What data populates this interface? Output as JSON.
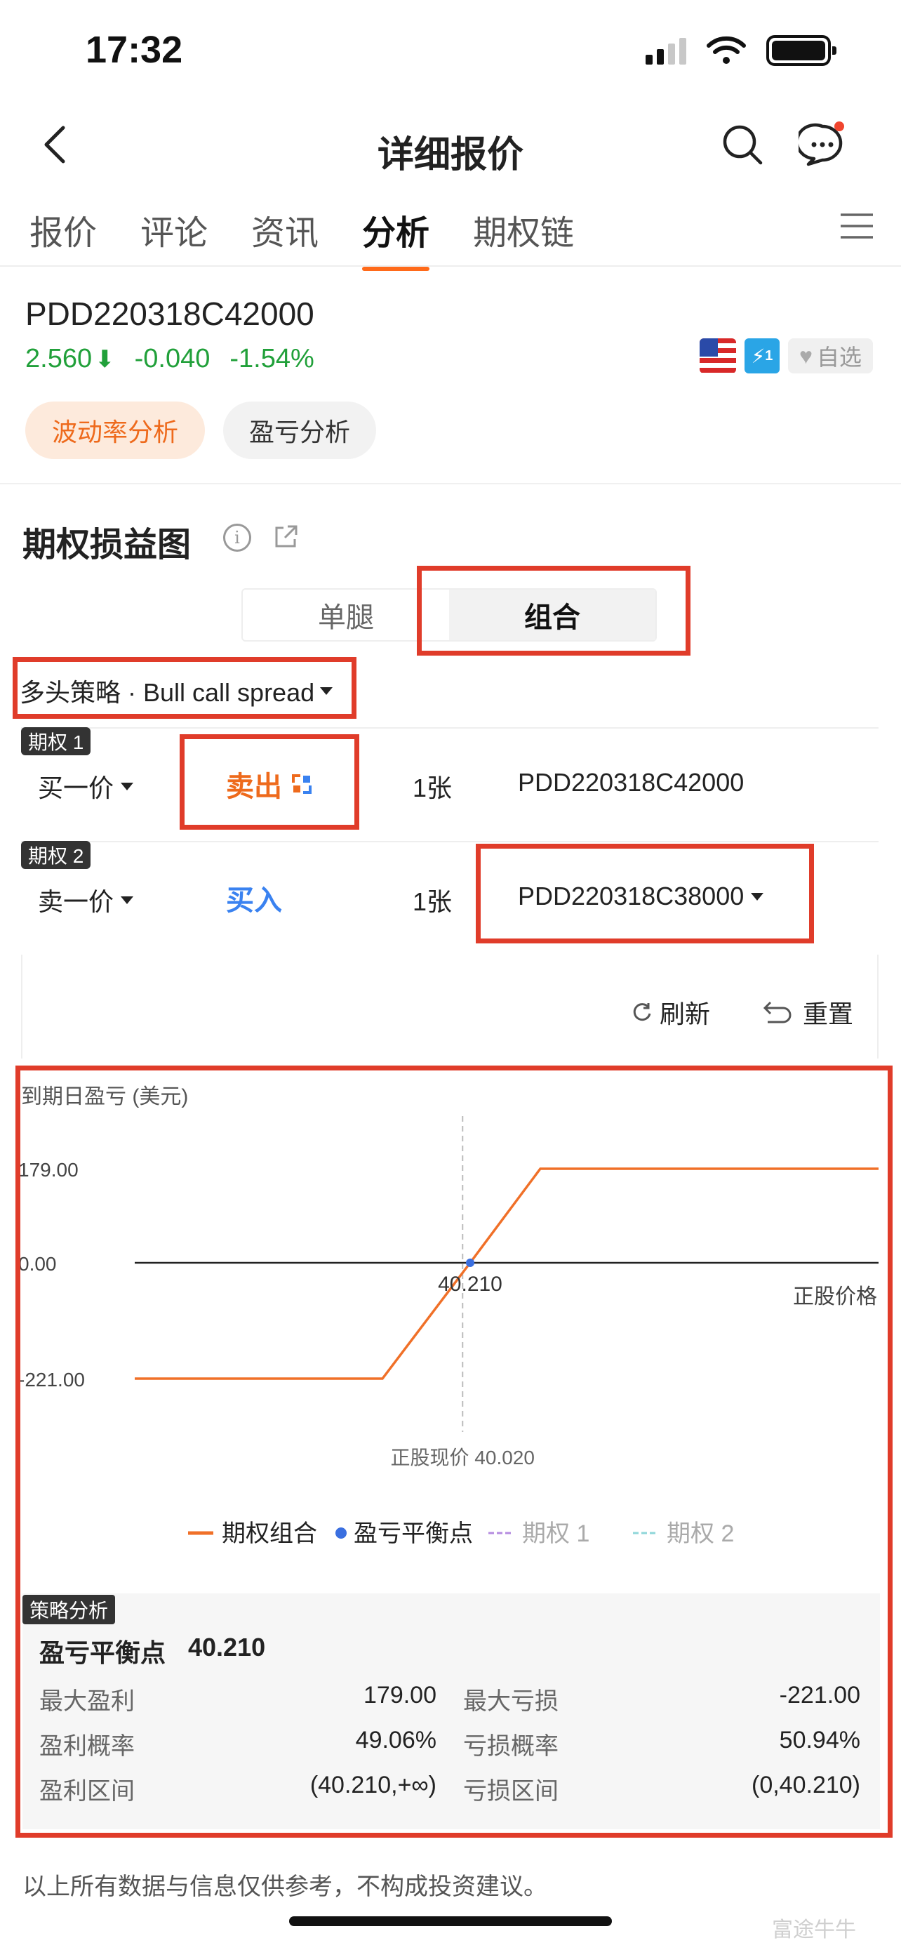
{
  "status": {
    "time": "17:32"
  },
  "nav": {
    "title": "详细报价"
  },
  "tabs": [
    {
      "label": "报价"
    },
    {
      "label": "评论"
    },
    {
      "label": "资讯"
    },
    {
      "label": "分析"
    },
    {
      "label": "期权链"
    }
  ],
  "quote": {
    "symbol": "PDD220318C42000",
    "price": "2.560",
    "change": "-0.040",
    "change_pct": "-1.54%",
    "watch_label": "自选",
    "level_badge": "1"
  },
  "pills": {
    "volatility": "波动率分析",
    "pnl": "盈亏分析"
  },
  "section": {
    "title": "期权损益图"
  },
  "segment": {
    "single": "单腿",
    "combo": "组合"
  },
  "strategy": {
    "label": "多头策略 · Bull call spread"
  },
  "options": [
    {
      "tag": "期权 1",
      "price_type": "买一价",
      "action": "卖出",
      "qty": "1张",
      "contract": "PDD220318C42000"
    },
    {
      "tag": "期权 2",
      "price_type": "卖一价",
      "action": "买入",
      "qty": "1张",
      "contract": "PDD220318C38000"
    }
  ],
  "actions": {
    "refresh": "刷新",
    "reset": "重置"
  },
  "chart_data": {
    "type": "line",
    "title": "到期日盈亏 (美元)",
    "xlabel": "正股价格",
    "ylabel": "到期日盈亏 (美元)",
    "y_ticks": [
      "179.00",
      "0.00",
      "-221.00"
    ],
    "x": [
      38.0,
      40.21,
      42.0
    ],
    "series": [
      {
        "name": "期权组合",
        "color": "#f07028",
        "points": [
          [
            30.0,
            -221.0
          ],
          [
            38.0,
            -221.0
          ],
          [
            40.21,
            0.0
          ],
          [
            42.0,
            179.0
          ],
          [
            50.0,
            179.0
          ]
        ]
      }
    ],
    "breakeven": {
      "label": "40.210",
      "x": 40.21,
      "y": 0
    },
    "current_price_label": "正股现价 40.020",
    "current_price": 40.02,
    "legend": [
      {
        "name": "期权组合",
        "style": "line",
        "color": "#f07028"
      },
      {
        "name": "盈亏平衡点",
        "style": "dot",
        "color": "#3a6fe0"
      },
      {
        "name": "期权 1",
        "style": "dash",
        "color": "#b58be0"
      },
      {
        "name": "期权 2",
        "style": "dash",
        "color": "#8ed6d9"
      }
    ]
  },
  "analysis": {
    "tag": "策略分析",
    "breakeven_label": "盈亏平衡点",
    "breakeven_value": "40.210",
    "rows": [
      {
        "l1": "最大盈利",
        "v1": "179.00",
        "l2": "最大亏损",
        "v2": "-221.00"
      },
      {
        "l1": "盈利概率",
        "v1": "49.06%",
        "l2": "亏损概率",
        "v2": "50.94%"
      },
      {
        "l1": "盈利区间",
        "v1": "(40.210,+∞)",
        "l2": "亏损区间",
        "v2": "(0,40.210)"
      }
    ]
  },
  "disclaimer": "以上所有数据与信息仅供参考，不构成投资建议。",
  "watermark": "富途牛牛"
}
